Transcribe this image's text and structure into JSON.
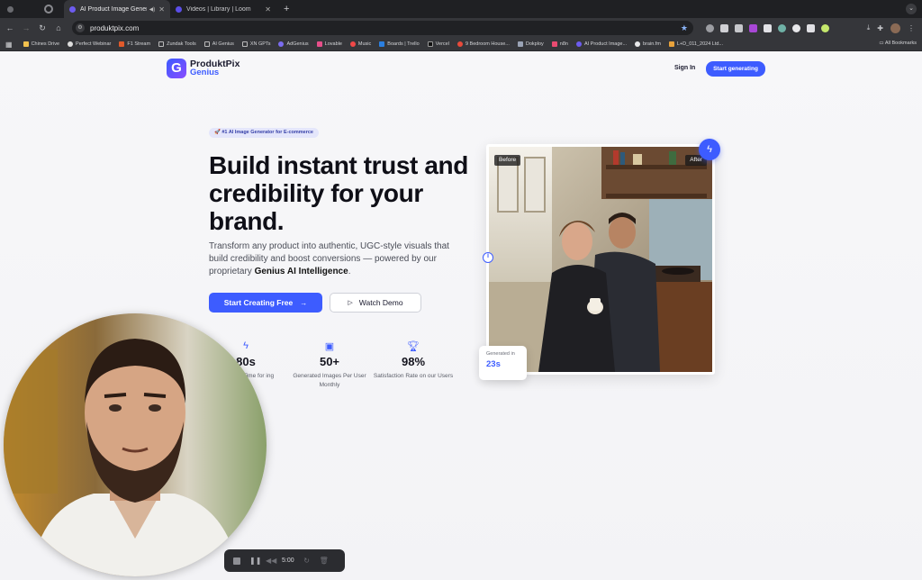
{
  "browser": {
    "tabs": [
      {
        "title": "AI Product Image Generator",
        "active": true,
        "audio": true
      },
      {
        "title": "Videos | Library | Loom",
        "active": false,
        "audio": false
      }
    ],
    "new_tab": "+",
    "url": "produktpix.com",
    "bookmarks": [
      "Chines Drive",
      "Perfect Webinar",
      "F1 Stream",
      "Zundak Tools",
      "AI Genius",
      "XN GPTs",
      "AdGenius",
      "Lovable",
      "Music",
      "Boards | Trello",
      "Vercel",
      "9 Bedroom House...",
      "Dokploy",
      "n8n",
      "AI Product Image...",
      "brain.fm",
      "L+D_011_2024 Ltd..."
    ],
    "all_bookmarks": "All Bookmarks"
  },
  "site": {
    "logo_mark": "G",
    "brand_name": "ProduktPix",
    "brand_sub": "Genius",
    "nav": {
      "sign_in": "Sign In",
      "cta": "Start generating"
    }
  },
  "hero": {
    "badge": "🚀 #1 AI Image Generator for E-commerce",
    "title": "Build instant trust and credibility for your brand.",
    "desc_pre": "Transform any product into authentic, UGC-style visuals that build credibility and boost conversions — powered by our proprietary ",
    "desc_bold": "Genius AI Intelligence",
    "desc_post": ".",
    "primary_cta": "Start Creating Free",
    "secondary_cta": "Watch Demo"
  },
  "stats": [
    {
      "icon": "lightning-icon",
      "value": "80s",
      "label": "Time for ing"
    },
    {
      "icon": "image-icon",
      "value": "50+",
      "label": "Generated Images Per User Monthly"
    },
    {
      "icon": "trophy-icon",
      "value": "98%",
      "label": "Satisfaction Rate on our Users"
    }
  ],
  "showcase": {
    "before_label": "Before",
    "after_label": "After",
    "generated_label": "Generated in",
    "generated_value": "23s"
  },
  "recorder": {
    "time": "5:00"
  },
  "colors": {
    "accent": "#3d5cff",
    "chrome_dark": "#35363a"
  }
}
